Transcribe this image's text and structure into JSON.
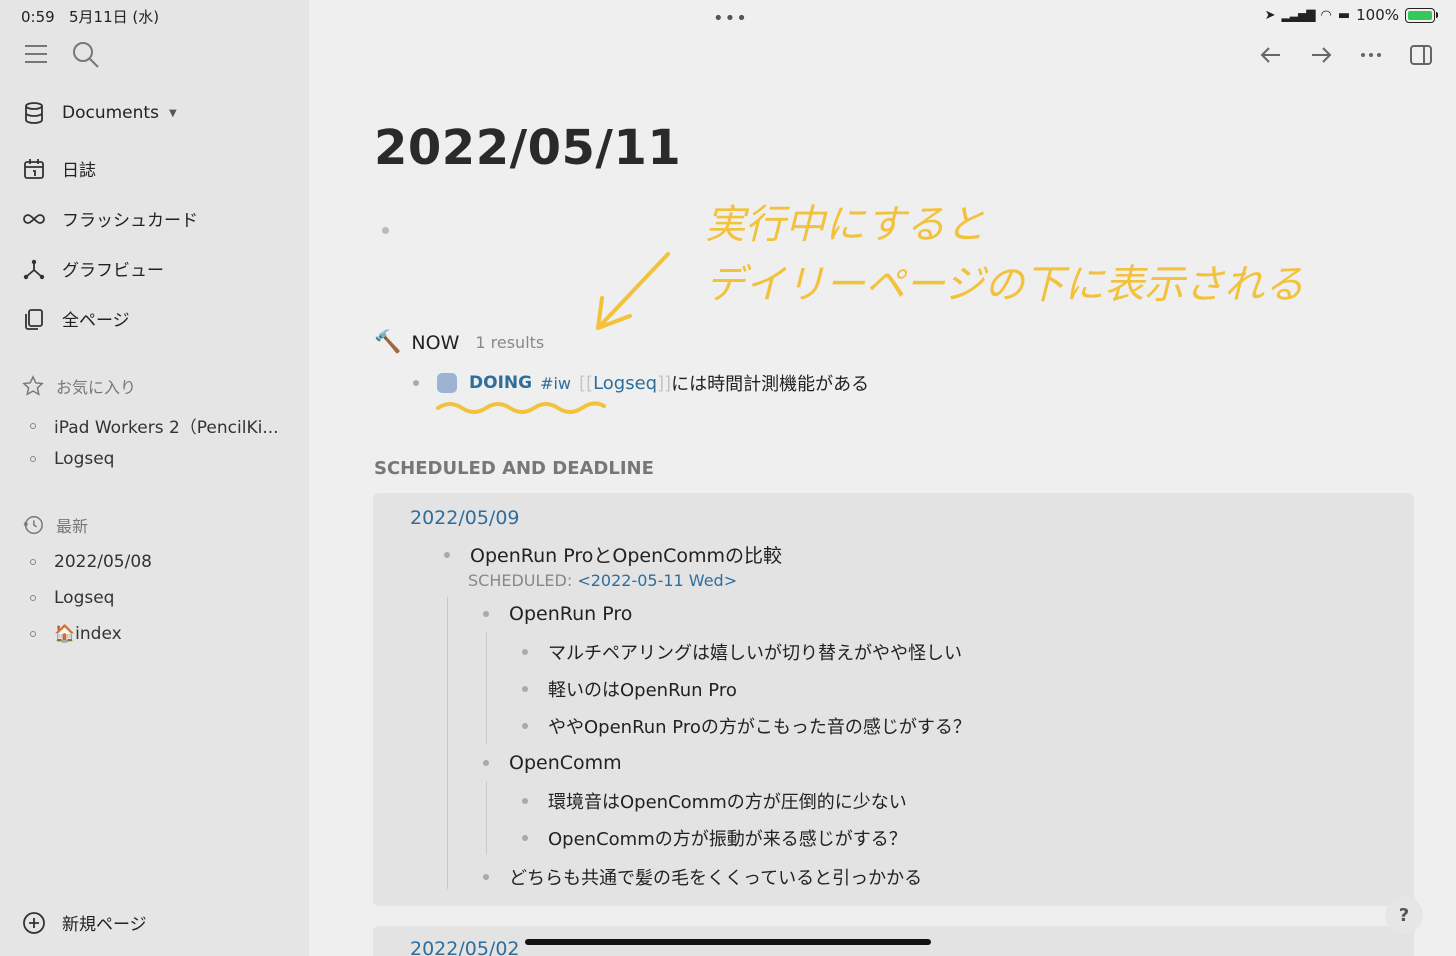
{
  "status": {
    "time": "0:59",
    "date": "5月11日 (水)",
    "battery": "100%"
  },
  "sidebar": {
    "nav": [
      {
        "label": "Documents"
      },
      {
        "label": "日誌"
      },
      {
        "label": "フラッシュカード"
      },
      {
        "label": "グラフビュー"
      },
      {
        "label": "全ページ"
      }
    ],
    "favorites_title": "お気に入り",
    "favorites": [
      {
        "label": "iPad Workers 2（PencilKi..."
      },
      {
        "label": "Logseq"
      }
    ],
    "recent_title": "最新",
    "recent": [
      {
        "label": "2022/05/08"
      },
      {
        "label": "Logseq"
      },
      {
        "label": "🏠index"
      }
    ],
    "new_page": "新規ページ"
  },
  "page": {
    "title": "2022/05/11",
    "annotation_line1": "実行中にすると",
    "annotation_line2": "デイリーページの下に表示される",
    "now": {
      "icon": "🔨",
      "label": "NOW",
      "count": "1 results",
      "task": {
        "marker": "DOING",
        "tag": "#iw",
        "open_bracket": "[[",
        "link": "Logseq",
        "close_bracket": "]]",
        "text": "には時間計測機能がある"
      }
    },
    "scheduled_title": "SCHEDULED AND DEADLINE",
    "scheduled": [
      {
        "date": "2022/05/09",
        "item": "OpenRun ProとOpenCommの比較",
        "scheduled_label": "SCHEDULED:",
        "scheduled_value": "<2022-05-11 Wed>",
        "children": [
          {
            "label": "OpenRun Pro",
            "children": [
              "マルチペアリングは嬉しいが切り替えがやや怪しい",
              "軽いのはOpenRun Pro",
              "ややOpenRun Proの方がこもった音の感じがする？"
            ]
          },
          {
            "label": "OpenComm",
            "children": [
              "環境音はOpenCommの方が圧倒的に少ない",
              "OpenCommの方が振動が来る感じがする？"
            ]
          },
          {
            "label": "どちらも共通で髪の毛をくくっていると引っかかる",
            "children": []
          }
        ]
      },
      {
        "date": "2022/05/02"
      }
    ],
    "help": "?"
  }
}
